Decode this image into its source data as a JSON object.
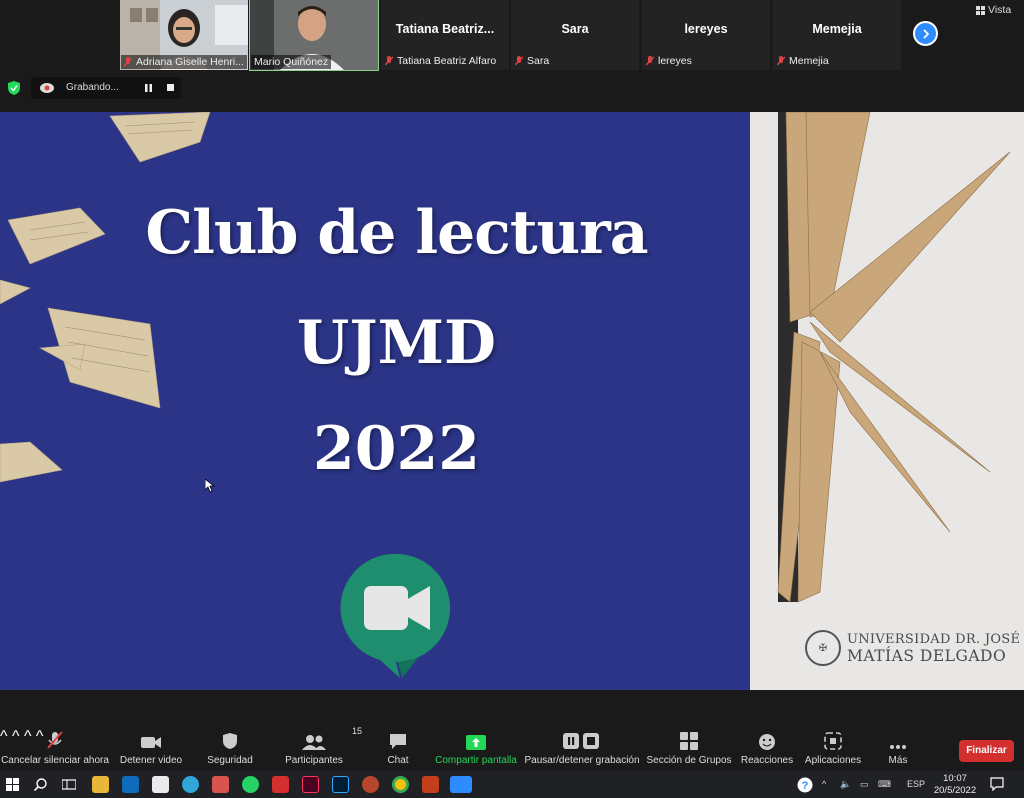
{
  "participants": [
    {
      "name": "Adriana Giselle Henri...",
      "video": true
    },
    {
      "name": "Mario Quiñónez",
      "video": true
    },
    {
      "title": "Tatiana  Beatriz...",
      "label": "Tatiana Beatriz Alfaro"
    },
    {
      "title": "Sara",
      "label": "Sara"
    },
    {
      "title": "lereyes",
      "label": "lereyes"
    },
    {
      "title": "Memejia",
      "label": "Memejia"
    }
  ],
  "view_label": "Vista",
  "recording": {
    "label": "Grabando..."
  },
  "slide": {
    "line1": "Club de lectura",
    "line2": "UJMD",
    "line3": "2022",
    "university_line1": "UNIVERSIDAD DR. JOSÉ",
    "university_line2": "MATÍAS DELGADO"
  },
  "toolbar": {
    "mute": "Cancelar silenciar ahora",
    "video": "Detener video",
    "security": "Seguridad",
    "participants": "Participantes",
    "participants_count": "15",
    "chat": "Chat",
    "share": "Compartir pantalla",
    "record": "Pausar/detener grabación",
    "breakout": "Sección de Grupos",
    "reactions": "Reacciones",
    "apps": "Aplicaciones",
    "more": "Más",
    "end": "Finalizar"
  },
  "taskbar": {
    "lang": "ESP",
    "time": "10:07",
    "date": "20/5/2022"
  },
  "colors": {
    "slide_blue": "#2b3486",
    "accent_blue": "#2d8cff",
    "share_green": "#23d959",
    "end_red": "#d32f2f",
    "meet_green": "#1e8e6e"
  }
}
